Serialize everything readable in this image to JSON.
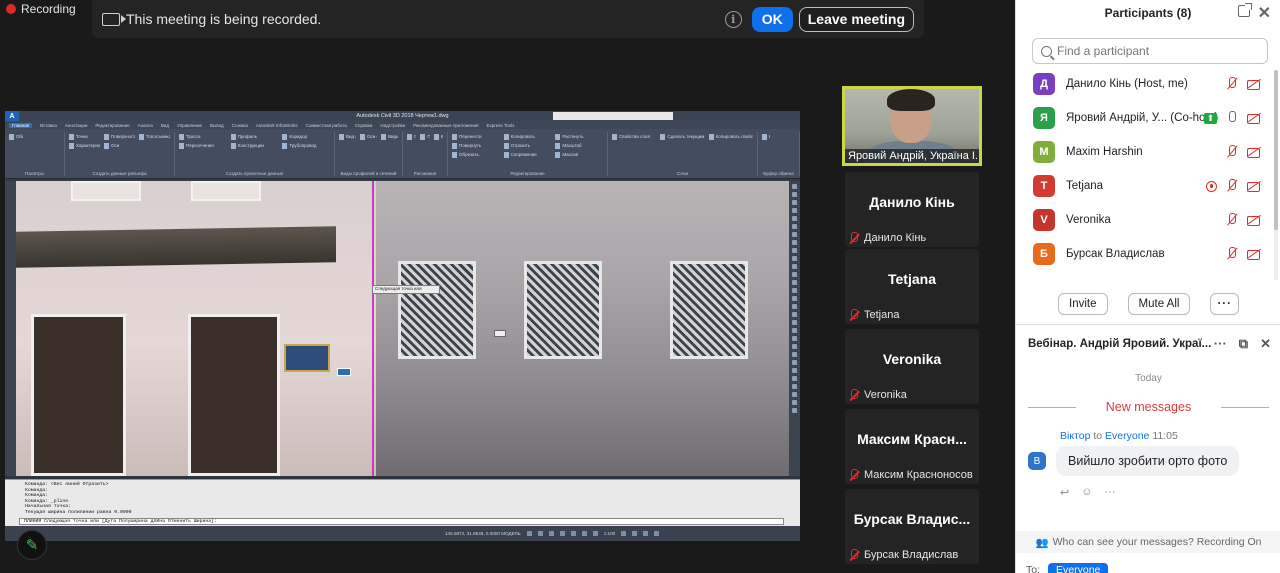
{
  "recording": {
    "label": "Recording"
  },
  "banner": {
    "message": "This meeting is being recorded.",
    "ok": "OK",
    "leave": "Leave meeting"
  },
  "shared_screen": {
    "app_title": "Autodesk Civil 3D 2018   Чертеж1.dwg",
    "logo": "A",
    "tooltip": "Следующая точка или",
    "ribbon_tabs": [
      "Главная",
      "Вставка",
      "Аннотации",
      "Редактирование",
      "Анализ",
      "Вид",
      "Управление",
      "Вывод",
      "Съемка",
      "Autodesk InfraWorks",
      "Совместная работа",
      "Справка",
      "Надстройки",
      "Рекомендованные приложения",
      "Express Tools"
    ],
    "ribbon_panels": [
      {
        "title": "Палитры",
        "items": [
          "Область инструментов"
        ]
      },
      {
        "title": "Создать данные рельефа",
        "items": [
          "Точки",
          "Поверхности",
          "Топосъемка",
          "Характерная линия",
          "Оси"
        ]
      },
      {
        "title": "Создать проектные данные",
        "items": [
          "Трасса",
          "Профиль",
          "Коридор",
          "Пересечения",
          "Конструкции",
          "Трубопровод"
        ]
      },
      {
        "title": "Виды профилей и сечений",
        "items": [
          "Вид профиля",
          "Оси сечений",
          "Виды сечения"
        ]
      },
      {
        "title": "Рисование",
        "items": [
          "Отрезок",
          "Полилиния",
          "Круг"
        ]
      },
      {
        "title": "Редактирование",
        "items": [
          "Перенести",
          "Копировать",
          "Растянуть",
          "Повернуть",
          "Отразить",
          "Масштаб",
          "Обрезать",
          "Сопряжение",
          "Массив"
        ]
      },
      {
        "title": "Слои",
        "items": [
          "Свойства слоя",
          "Сделать текущим",
          "Копировать свойства слоя"
        ]
      },
      {
        "title": "Буфер обмена",
        "items": [
          "Вставить"
        ]
      }
    ],
    "command_lines": [
      "Команда: <Вес линий Отразить>",
      "Команда:",
      "Команда:",
      "Команда: _pline",
      "Начальная точка:",
      "Текущая ширина полилинии равна 0.0000"
    ],
    "command_input": "ПЛИНИЯ Следующая точка или [Дуга Полуширина длИна Отменить Ширина]:",
    "status_coords": "145.5872, 31.8548, 0.0000   МОДЕЛЬ",
    "status_scale": "1:100"
  },
  "video": {
    "active_speaker": "Яровий Андрій, Україна І..."
  },
  "tiles": [
    {
      "big": "Данило Кінь",
      "small": "Данило Кінь"
    },
    {
      "big": "Tetjana",
      "small": "Tetjana"
    },
    {
      "big": "Veronika",
      "small": "Veronika"
    },
    {
      "big": "Максим Красн...",
      "small": "Максим Красноносов"
    },
    {
      "big": "Бурсак Владис...",
      "small": "Бурсак Владислав"
    }
  ],
  "participants": {
    "title": "Participants (8)",
    "search_placeholder": "Find a participant",
    "list": [
      {
        "initial": "Д",
        "name": "Данило Кінь (Host, me)",
        "color": "#7a3fbf"
      },
      {
        "initial": "Я",
        "name": "Яровий Андрій, У...  (Co-host)",
        "color": "#2aa04a"
      },
      {
        "initial": "M",
        "name": "Maxim Harshin",
        "color": "#7fae3d"
      },
      {
        "initial": "T",
        "name": "Tetjana",
        "color": "#d23b2f"
      },
      {
        "initial": "V",
        "name": "Veronika",
        "color": "#c5352e"
      },
      {
        "initial": "Б",
        "name": "Бурсак Владислав",
        "color": "#e86a1c"
      }
    ],
    "invite": "Invite",
    "mute_all": "Mute All",
    "more": "···"
  },
  "chat": {
    "title": "Вебінар. Андрій Яровий. Украї...",
    "today": "Today",
    "new_messages": "New messages",
    "sender": "Віктор",
    "to": "to",
    "recipient": "Everyone",
    "time": "11:05",
    "avatar": "В",
    "message": "Вийшло зробити орто фото",
    "footer": "Who can see your messages? Recording On",
    "to_label": "To:",
    "to_target": "Everyone"
  },
  "colors": {
    "accent": "#0e71eb",
    "speaker_border": "#ccd64a",
    "muted": "#e22a2a"
  }
}
